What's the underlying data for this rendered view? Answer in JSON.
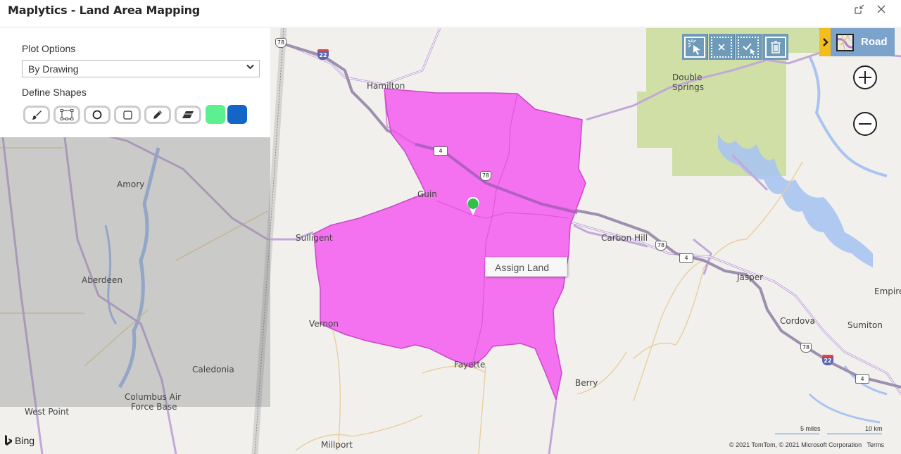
{
  "window": {
    "title": "Maplytics - Land Area Mapping",
    "restore_icon": "restore-down-icon",
    "close_icon": "close-icon"
  },
  "panel": {
    "plot_options_label": "Plot Options",
    "plot_options_selected": "By Drawing",
    "define_shapes_label": "Define Shapes",
    "shape_tools": [
      {
        "name": "brush-tool",
        "icon": "paintbrush-icon"
      },
      {
        "name": "polygon-select-tool",
        "icon": "polygon-select-icon"
      },
      {
        "name": "circle-tool",
        "icon": "circle-icon"
      },
      {
        "name": "rectangle-tool",
        "icon": "square-icon"
      },
      {
        "name": "pencil-tool",
        "icon": "pencil-icon"
      },
      {
        "name": "eraser-tool",
        "icon": "eraser-icon"
      }
    ],
    "colors": {
      "green": "#5cf090",
      "blue": "#1565c8"
    }
  },
  "drawing_toolbar": [
    {
      "name": "select-shape",
      "icon": "pointer-select-icon"
    },
    {
      "name": "clear-selection",
      "icon": "clear-selection-icon"
    },
    {
      "name": "confirm-selection",
      "icon": "check-selection-icon"
    },
    {
      "name": "delete",
      "icon": "trash-icon"
    }
  ],
  "map_type": {
    "label": "Road",
    "icon": "chevron-right-icon"
  },
  "zoom": {
    "in": "+",
    "out": "−"
  },
  "context_menu": {
    "assign_land": "Assign Land"
  },
  "polygon_color": "#f36af0",
  "map_labels": {
    "hamilton": "Hamilton",
    "guin": "Guin",
    "sulligent": "Sulligent",
    "vernon": "Vernon",
    "fayette": "Fayette",
    "berry": "Berry",
    "carbon_hill": "Carbon Hill",
    "jasper": "Jasper",
    "cordova": "Cordova",
    "sumiton": "Sumiton",
    "empire": "Empire",
    "double": "Double",
    "springs": "Springs",
    "amory": "Amory",
    "aberdeen": "Aberdeen",
    "caledonia": "Caledonia",
    "columbus_air": "Columbus Air",
    "force_base": "Force Base",
    "west_point": "West Point",
    "millport": "Millport"
  },
  "road_shields": {
    "us78": "78",
    "i22": "22",
    "sr4": "4"
  },
  "attribution": {
    "bing": "Bing",
    "scale_miles": "5 miles",
    "scale_km": "10 km",
    "copyright": "© 2021 TomTom, © 2021 Microsoft Corporation",
    "terms": "Terms"
  }
}
